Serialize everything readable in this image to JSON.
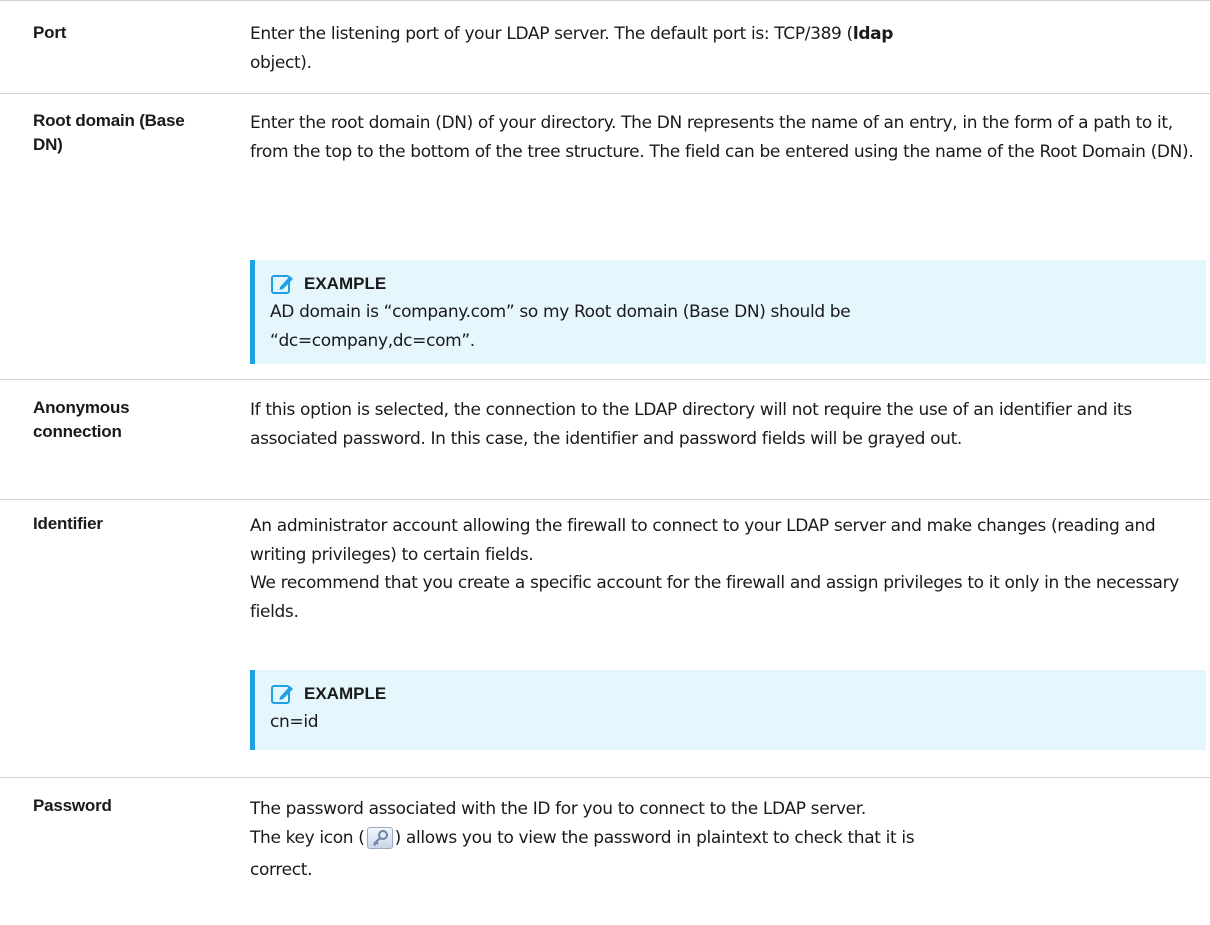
{
  "rows": [
    {
      "label": "Port",
      "desc_a": "Enter the listening port of your LDAP server. The default port is: TCP/389 (",
      "desc_bold": "ldap",
      "desc_b": "object)."
    },
    {
      "label": "Root domain (Base DN)",
      "desc": "Enter the root domain (DN) of your directory. The DN represents the name of an entry, in the form of a path to it, from the top to the bottom of the tree structure. The field can be entered using the name of the Root Domain (DN).",
      "callout": {
        "icon": "edit-note-icon",
        "title": "EXAMPLE",
        "text": "AD domain is “company.com” so my Root domain (Base DN) should be “dc=company,dc=com”."
      }
    },
    {
      "label": "Anonymous connection",
      "desc": "If this option is selected, the connection to the LDAP directory will not require the use of an identifier and its associated password. In this case, the identifier and password fields will be grayed out."
    },
    {
      "label": "Identifier",
      "desc_line1": "An administrator account allowing the firewall to connect to your LDAP server and make changes (reading and writing privileges) to certain fields.",
      "desc_line2": "We recommend that you create a specific account for the firewall and assign privileges to it only in the necessary fields.",
      "callout": {
        "icon": "edit-note-icon",
        "title": "EXAMPLE",
        "text": "cn=id"
      }
    },
    {
      "label": "Password",
      "desc_line1": "The password associated with the ID for you to connect to the LDAP server.",
      "desc_line2_a": "The key icon (",
      "desc_line2_icon": "key-icon",
      "desc_line2_b": ") allows you to view the password in plaintext to check that it is",
      "desc_line3": "correct."
    }
  ],
  "colors": {
    "callout_bg": "#e6f6fd",
    "callout_border": "#1da1e2",
    "divider": "#d0d0d0"
  }
}
